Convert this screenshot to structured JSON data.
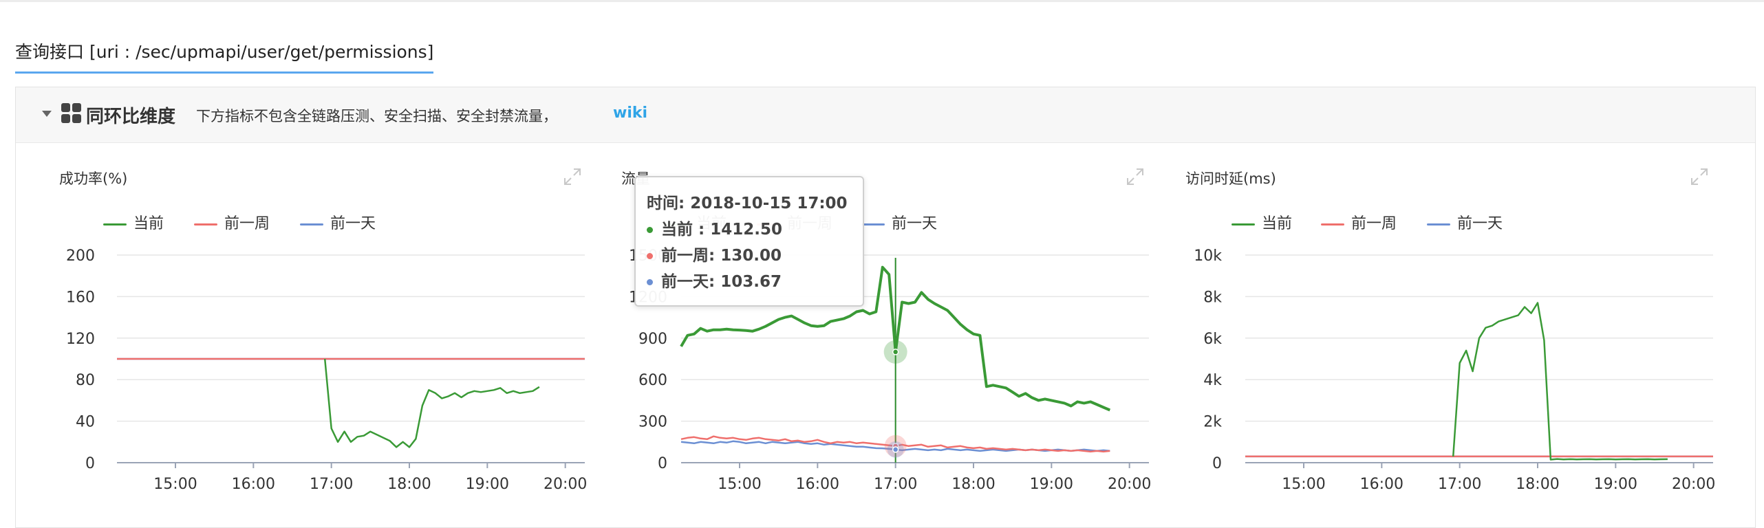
{
  "page_title": "查询接口 [uri : /sec/upmapi/user/get/permissions]",
  "panel": {
    "title": "同环比维度",
    "description": "下方指标不包含全链路压测、安全扫描、安全封禁流量，",
    "wiki_label": "wiki"
  },
  "colors": {
    "current": "#3a9a36",
    "last_week": "#ef6f6c",
    "yesterday": "#6b8fd3"
  },
  "legend": {
    "current": "当前",
    "last_week": "前一周",
    "yesterday": "前一天"
  },
  "tooltip": {
    "time": "时间: 2018-10-15 17:00",
    "current": "当前   : 1412.50",
    "last_week": "前一周: 130.00",
    "yesterday": "前一天: 103.67"
  },
  "chart_data": [
    {
      "type": "line",
      "title": "成功率(%)",
      "x_ticks": [
        "15:00",
        "16:00",
        "17:00",
        "18:00",
        "19:00",
        "20:00"
      ],
      "y_ticks": [
        "0",
        "40",
        "80",
        "120",
        "160",
        "200"
      ],
      "ylim": [
        0,
        200
      ],
      "x_range": [
        "14:15",
        "20:15"
      ],
      "series": [
        {
          "name": "当前",
          "color_key": "current",
          "start": "16:55",
          "step_min": 5,
          "values": [
            100,
            33,
            20,
            30,
            20,
            25,
            26,
            30,
            27,
            24,
            21,
            15,
            20,
            15,
            23,
            55,
            70,
            67,
            62,
            64,
            67,
            63,
            67,
            69,
            68,
            69,
            70,
            72,
            67,
            69,
            67,
            68,
            69,
            73
          ]
        },
        {
          "name": "前一周",
          "color_key": "last_week",
          "start": "14:15",
          "step_min": 360,
          "values": [
            100,
            100
          ]
        },
        {
          "name": "前一天",
          "color_key": "yesterday",
          "start": "14:15",
          "step_min": 360,
          "values": [
            100,
            100
          ]
        }
      ]
    },
    {
      "type": "line",
      "title": "流量",
      "x_ticks": [
        "15:00",
        "16:00",
        "17:00",
        "18:00",
        "19:00",
        "20:00"
      ],
      "y_ticks": [
        "0",
        "300",
        "600",
        "900",
        "1200",
        "1500"
      ],
      "ylim": [
        0,
        1500
      ],
      "x_range": [
        "14:15",
        "20:15"
      ],
      "highlight_x": "17:00",
      "series": [
        {
          "name": "当前",
          "color_key": "current",
          "start": "14:15",
          "step_min": 5,
          "values": [
            840,
            920,
            930,
            970,
            950,
            960,
            960,
            965,
            960,
            958,
            955,
            950,
            965,
            985,
            1010,
            1035,
            1050,
            1060,
            1035,
            1010,
            990,
            985,
            990,
            1020,
            1030,
            1040,
            1060,
            1090,
            1100,
            1075,
            1090,
            1412,
            1360,
            800,
            1160,
            1150,
            1160,
            1230,
            1180,
            1150,
            1125,
            1100,
            1050,
            1000,
            960,
            930,
            920,
            550,
            560,
            550,
            540,
            510,
            480,
            500,
            470,
            450,
            460,
            450,
            440,
            430,
            410,
            440,
            430,
            440,
            420,
            400,
            380
          ]
        },
        {
          "name": "前一周",
          "color_key": "last_week",
          "start": "14:15",
          "step_min": 5,
          "values": [
            170,
            180,
            185,
            175,
            170,
            190,
            180,
            175,
            180,
            170,
            165,
            175,
            180,
            170,
            165,
            160,
            170,
            155,
            160,
            150,
            155,
            165,
            150,
            140,
            150,
            145,
            150,
            140,
            145,
            140,
            135,
            130,
            125,
            120,
            130,
            120,
            125,
            130,
            115,
            120,
            125,
            110,
            115,
            120,
            110,
            105,
            110,
            100,
            105,
            100,
            95,
            100,
            95,
            90,
            95,
            90,
            95,
            90,
            85,
            90,
            85,
            90,
            85,
            80,
            85,
            80,
            85
          ]
        },
        {
          "name": "前一天",
          "color_key": "yesterday",
          "start": "14:15",
          "step_min": 5,
          "values": [
            150,
            145,
            140,
            150,
            145,
            140,
            150,
            145,
            155,
            150,
            140,
            145,
            150,
            140,
            150,
            145,
            140,
            145,
            150,
            140,
            135,
            140,
            130,
            135,
            130,
            125,
            120,
            115,
            115,
            110,
            105,
            104,
            100,
            95,
            90,
            95,
            100,
            95,
            90,
            95,
            90,
            100,
            95,
            90,
            95,
            90,
            85,
            90,
            95,
            90,
            85,
            90,
            95,
            90,
            95,
            90,
            85,
            90,
            95,
            90,
            85,
            90,
            95,
            90,
            85,
            90,
            85
          ]
        }
      ]
    },
    {
      "type": "line",
      "title": "访问时延(ms)",
      "x_ticks": [
        "15:00",
        "16:00",
        "17:00",
        "18:00",
        "19:00",
        "20:00"
      ],
      "y_ticks": [
        "0",
        "2k",
        "4k",
        "6k",
        "8k",
        "10k"
      ],
      "ylim": [
        0,
        10000
      ],
      "x_range": [
        "14:15",
        "20:15"
      ],
      "series": [
        {
          "name": "当前",
          "color_key": "current",
          "start": "16:55",
          "step_min": 5,
          "values": [
            300,
            4800,
            5400,
            4400,
            6000,
            6500,
            6600,
            6800,
            6900,
            7000,
            7100,
            7500,
            7200,
            7700,
            5900,
            150,
            180,
            160,
            170,
            160,
            165,
            170,
            160,
            165,
            170,
            160,
            165,
            170,
            160,
            165,
            170,
            160,
            165,
            170
          ]
        },
        {
          "name": "前一周",
          "color_key": "last_week",
          "start": "14:15",
          "step_min": 360,
          "values": [
            300,
            300
          ]
        },
        {
          "name": "前一天",
          "color_key": "yesterday",
          "start": "14:15",
          "step_min": 360,
          "values": [
            300,
            300
          ]
        }
      ]
    }
  ]
}
